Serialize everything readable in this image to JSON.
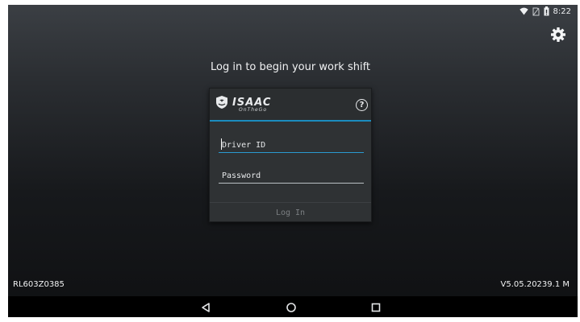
{
  "status_bar": {
    "time": "8:22",
    "icons": [
      "wifi-icon",
      "sim-off-icon",
      "battery-icon"
    ]
  },
  "header": {
    "settings_icon": "gear-icon"
  },
  "main": {
    "headline": "Log in to begin your work shift"
  },
  "login_card": {
    "brand": {
      "name": "ISAAC",
      "sub": "OnTheGo"
    },
    "help_label": "?",
    "driver_id": {
      "placeholder": "Driver ID",
      "value": ""
    },
    "password": {
      "placeholder": "Password",
      "value": ""
    },
    "login_label": "Log In"
  },
  "footer": {
    "device_id": "RL603Z0385",
    "version": "V5.05.20239.1 M"
  },
  "nav_bar": {
    "icons": [
      "back-icon",
      "home-icon",
      "recents-icon"
    ]
  },
  "colors": {
    "accent": "#1b8cbf",
    "card_bg": "#2f3234",
    "text": "#f1f2f3"
  }
}
